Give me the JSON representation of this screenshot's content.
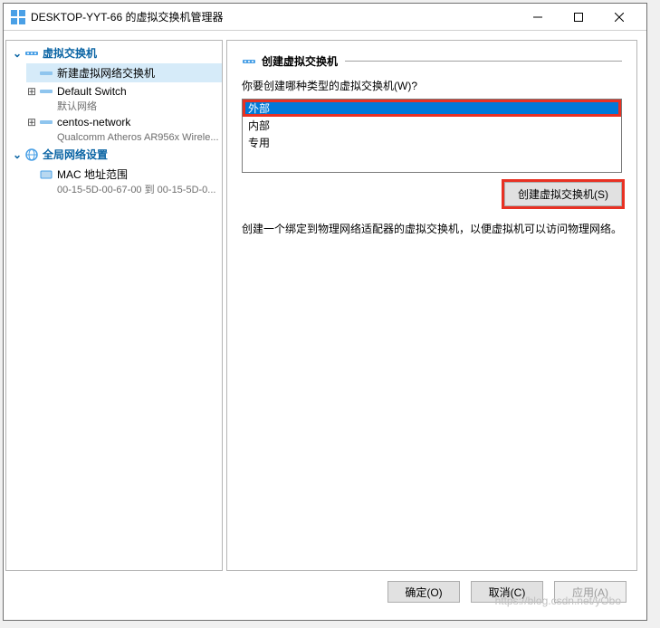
{
  "window": {
    "title": "DESKTOP-YYT-66 的虚拟交换机管理器",
    "minimize": "—",
    "maximize": "□",
    "close": "✕"
  },
  "sidebar": {
    "section1": {
      "label": "虚拟交换机",
      "items": [
        {
          "label": "新建虚拟网络交换机",
          "sub": ""
        },
        {
          "label": "Default Switch",
          "sub": "默认网络"
        },
        {
          "label": "centos-network",
          "sub": "Qualcomm Atheros AR956x Wirele..."
        }
      ]
    },
    "section2": {
      "label": "全局网络设置",
      "items": [
        {
          "label": "MAC 地址范围",
          "sub": "00-15-5D-00-67-00 到 00-15-5D-0..."
        }
      ]
    }
  },
  "main": {
    "header": "创建虚拟交换机",
    "question": "你要创建哪种类型的虚拟交换机(W)?",
    "options": [
      "外部",
      "内部",
      "专用"
    ],
    "create_button": "创建虚拟交换机(S)",
    "description": "创建一个绑定到物理网络适配器的虚拟交换机，以便虚拟机可以访问物理网络。"
  },
  "footer": {
    "ok": "确定(O)",
    "cancel": "取消(C)",
    "apply": "应用(A)"
  },
  "watermark": "https://blog.csdn.net/yObo"
}
